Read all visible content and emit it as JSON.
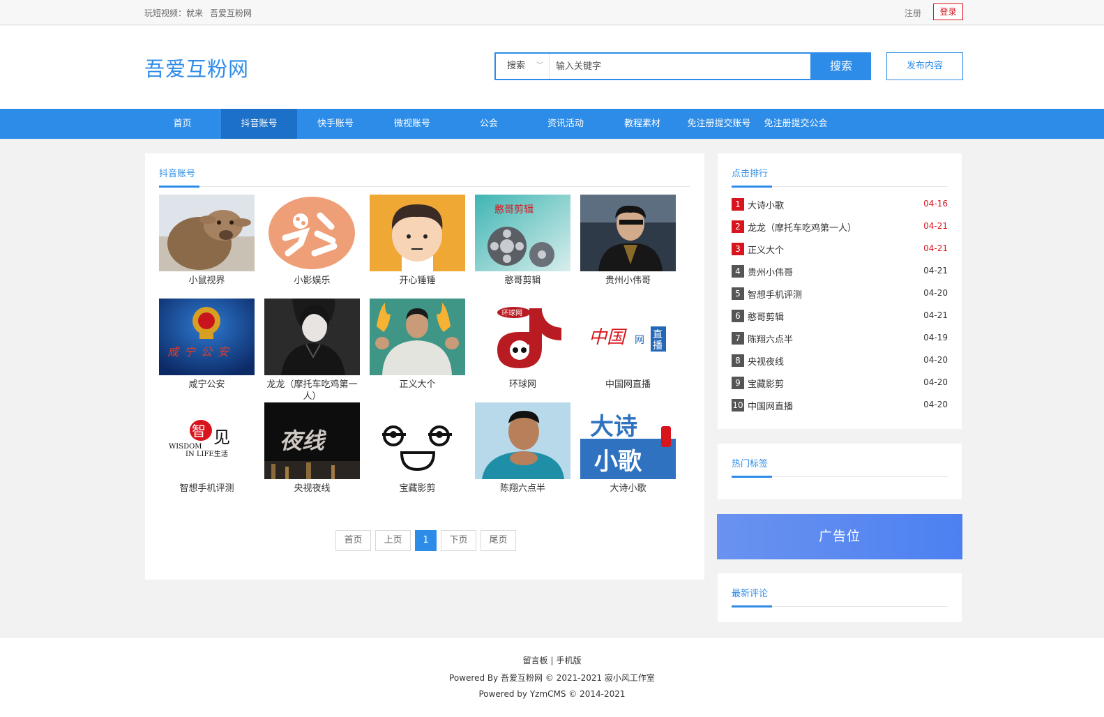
{
  "topbar": {
    "slogan_prefix": "玩短视频：就来",
    "slogan_site": "吾爱互粉网",
    "register": "注册",
    "login": "登录"
  },
  "header": {
    "logo": "吾爱互粉网",
    "search_type": "搜索",
    "search_placeholder": "输入关键字",
    "search_button": "搜索",
    "publish_button": "发布内容"
  },
  "nav": {
    "items": [
      "首页",
      "抖音账号",
      "快手账号",
      "微视账号",
      "公会",
      "资讯活动",
      "教程素材",
      "免注册提交账号",
      "免注册提交公会"
    ],
    "active": "抖音账号"
  },
  "main": {
    "title": "抖音账号",
    "accounts": [
      "小鼠视界",
      "小影娱乐",
      "开心锤锤",
      "憨哥剪辑",
      "贵州小伟哥",
      "咸宁公安",
      "龙龙（摩托车吃鸡第一人）",
      "正义大个",
      "环球网",
      "中国网直播",
      "智想手机评测",
      "央视夜线",
      "宝藏影剪",
      "陈翔六点半",
      "大诗小歌"
    ],
    "thumb_text": {
      "hange": "憨哥剪辑",
      "xianning": "咸宁公安",
      "huanqiu": "环球网",
      "zhongguo": "中国",
      "wang": "网",
      "zhi": "直",
      "bo": "播",
      "zhi_big": "智",
      "jian": "见",
      "wisdom": "WISDOM",
      "inlife": "IN LIFE生活",
      "yexian": "夜线",
      "dashi": "大诗",
      "xiaoge": "小歌"
    }
  },
  "pager": {
    "first": "首页",
    "prev": "上页",
    "current": "1",
    "next": "下页",
    "last": "尾页"
  },
  "ranking": {
    "title": "点击排行",
    "items": [
      {
        "num": "1",
        "name": "大诗小歌",
        "date": "04-16"
      },
      {
        "num": "2",
        "name": "龙龙（摩托车吃鸡第一人）",
        "date": "04-21"
      },
      {
        "num": "3",
        "name": "正义大个",
        "date": "04-21"
      },
      {
        "num": "4",
        "name": "贵州小伟哥",
        "date": "04-21"
      },
      {
        "num": "5",
        "name": "智想手机评测",
        "date": "04-20"
      },
      {
        "num": "6",
        "name": "憨哥剪辑",
        "date": "04-21"
      },
      {
        "num": "7",
        "name": "陈翔六点半",
        "date": "04-19"
      },
      {
        "num": "8",
        "name": "央视夜线",
        "date": "04-20"
      },
      {
        "num": "9",
        "name": "宝藏影剪",
        "date": "04-20"
      },
      {
        "num": "10",
        "name": "中国网直播",
        "date": "04-20"
      }
    ]
  },
  "tags": {
    "title": "热门标签"
  },
  "ad": {
    "text": "广告位"
  },
  "comments": {
    "title": "最新评论"
  },
  "footer": {
    "guestbook": "留言板",
    "divider": "|",
    "mobile": "手机版",
    "powered_prefix": "Powered By",
    "powered_site": "吾爱互粉网",
    "copyright": "© 2021-2021 寂小风工作室",
    "cms": "Powered by YzmCMS © 2014-2021"
  },
  "colors": {
    "accent": "#2d8ce8",
    "hot": "#d8151d",
    "nav_active": "#1c70c7"
  }
}
